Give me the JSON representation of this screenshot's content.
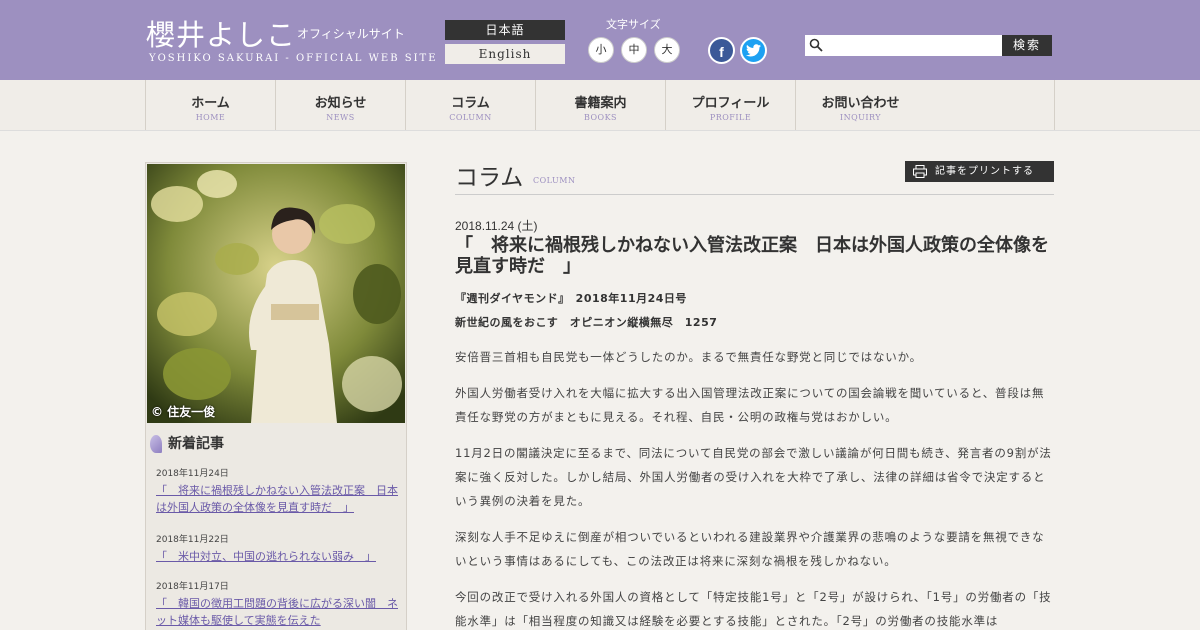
{
  "header": {
    "site_name": "櫻井よしこ",
    "site_official": "オフィシャルサイト",
    "site_subtitle": "YOSHIKO SAKURAI - OFFICIAL WEB SITE",
    "lang_ja": "日本語",
    "lang_en": "English",
    "font_size_label": "文字サイズ",
    "font_sizes": [
      "小",
      "中",
      "大"
    ],
    "facebook": "f",
    "twitter": "t",
    "search_placeholder": "",
    "search_button": "検索"
  },
  "nav": [
    {
      "ja": "ホーム",
      "en": "HOME"
    },
    {
      "ja": "お知らせ",
      "en": "NEWS"
    },
    {
      "ja": "コラム",
      "en": "COLUMN"
    },
    {
      "ja": "書籍案内",
      "en": "BOOKS"
    },
    {
      "ja": "プロフィール",
      "en": "PROFILE"
    },
    {
      "ja": "お問い合わせ",
      "en": "INQUIRY"
    }
  ],
  "sidebar": {
    "photo_credit": "© 住友一俊",
    "news_heading": "新着記事",
    "news": [
      {
        "date": "2018年11月24日",
        "title": "「　将来に禍根残しかねない入管法改正案　日本は外国人政策の全体像を見直す時だ　」"
      },
      {
        "date": "2018年11月22日",
        "title": "「　米中対立、中国の逃れられない弱み　」"
      },
      {
        "date": "2018年11月17日",
        "title": "「　韓国の徴用工問題の背後に広がる深い闇　ネット媒体も駆使して実態を伝えた"
      }
    ]
  },
  "main": {
    "section_title": "コラム",
    "section_title_en": "COLUMN",
    "print_button": "記事をプリントする",
    "date": "2018.11.24 (土)",
    "title": "「　将来に禍根残しかねない入管法改正案　日本は外国人政策の全体像を見直す時だ　」",
    "publication": "『週刊ダイヤモンド』　2018年11月24日号",
    "series": "新世紀の風をおこす　オピニオン縦横無尽　1257",
    "paragraphs": [
      "安倍晋三首相も自民党も一体どうしたのか。まるで無責任な野党と同じではないか。",
      "外国人労働者受け入れを大幅に拡大する出入国管理法改正案についての国会論戦を聞いていると、普段は無責任な野党の方がまともに見える。それ程、自民・公明の政権与党はおかしい。",
      "11月2日の閣議決定に至るまで、同法について自民党の部会で激しい議論が何日間も続き、発言者の9割が法案に強く反対した。しかし結局、外国人労働者の受け入れを大枠で了承し、法律の詳細は省令で決定するという異例の決着を見た。",
      "深刻な人手不足ゆえに倒産が相ついでいるといわれる建設業界や介護業界の悲鳴のような要請を無視できないという事情はあるにしても、この法改正は将来に深刻な禍根を残しかねない。",
      "今回の改正で受け入れる外国人の資格として「特定技能1号」と「2号」が設けられ、「1号」の労働者の「技能水準」は「相当程度の知識又は経験を必要とする技能」とされた。「2号」の労働者の技能水準は"
    ]
  },
  "colors": {
    "header_bg": "#9d90c0",
    "accent": "#6a5aa8",
    "page_bg": "#f3f1ed"
  }
}
